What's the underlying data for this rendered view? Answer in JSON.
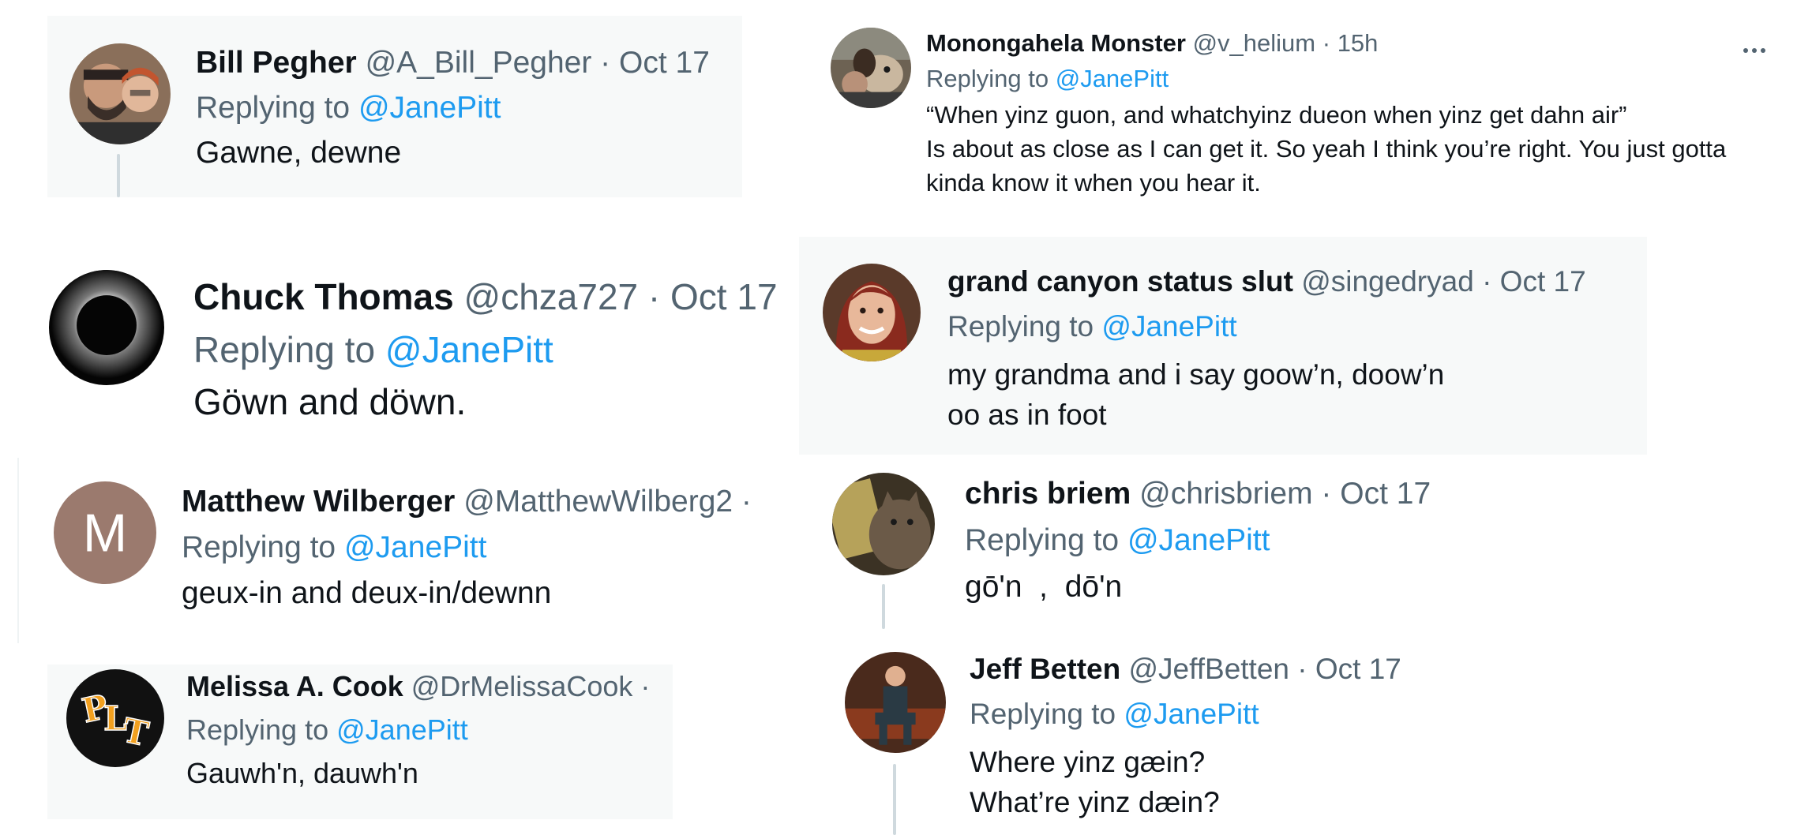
{
  "replying_to_label": "Replying to",
  "tweets": [
    {
      "id": "bill",
      "name": "Bill Pegher",
      "handle": "@A_Bill_Pegher",
      "date": "Oct 17",
      "mention": "@JanePitt",
      "lines": [
        "Gawne, dewne"
      ],
      "avatar_icon": "person-avatar-icon"
    },
    {
      "id": "chuck",
      "name": "Chuck Thomas",
      "handle": "@chza727",
      "date": "Oct 17",
      "mention": "@JanePitt",
      "lines": [
        "Göwn and döwn."
      ],
      "avatar_icon": "eclipse-avatar-icon"
    },
    {
      "id": "matthew",
      "name": "Matthew Wilberger",
      "handle": "@MatthewWilberg2",
      "mention": "@JanePitt",
      "lines": [
        "geux-in and deux-in/dewnn"
      ],
      "avatar_letter": "M",
      "avatar_color": "#9b7a6e"
    },
    {
      "id": "melissa",
      "name": "Melissa A. Cook",
      "handle": "@DrMelissaCook",
      "mention": "@JanePitt",
      "lines": [
        "Gauwh'n, dauwh'n"
      ],
      "avatar_text": "PLT",
      "avatar_icon": "plt-logo-avatar-icon"
    },
    {
      "id": "monongahela",
      "name": "Monongahela Monster",
      "handle": "@v_helium",
      "date": "15h",
      "mention": "@JanePitt",
      "lines": [
        "“When yinz guon, and whatchyinz dueon when yinz get dahn air”",
        "Is about as close as I can get it. So yeah I think you’re right. You just gotta",
        "kinda know it when you hear it."
      ],
      "avatar_icon": "dog-avatar-icon"
    },
    {
      "id": "grandcanyon",
      "name": "grand canyon status slut",
      "handle": "@singedryad",
      "date": "Oct 17",
      "mention": "@JanePitt",
      "lines": [
        "my grandma and i say goow’n, doow’n",
        "oo as in foot"
      ],
      "avatar_icon": "woman-avatar-icon"
    },
    {
      "id": "chris",
      "name": "chris briem",
      "handle": "@chrisbriem",
      "date": "Oct 17",
      "mention": "@JanePitt",
      "lines": [
        "gō'n  ,  dō'n"
      ],
      "avatar_icon": "cat-avatar-icon"
    },
    {
      "id": "jeff",
      "name": "Jeff Betten",
      "handle": "@JeffBetten",
      "date": "Oct 17",
      "mention": "@JanePitt",
      "lines": [
        "Where yinz gæin?",
        "What’re yinz dæin?"
      ],
      "avatar_icon": "seated-man-avatar-icon"
    }
  ]
}
